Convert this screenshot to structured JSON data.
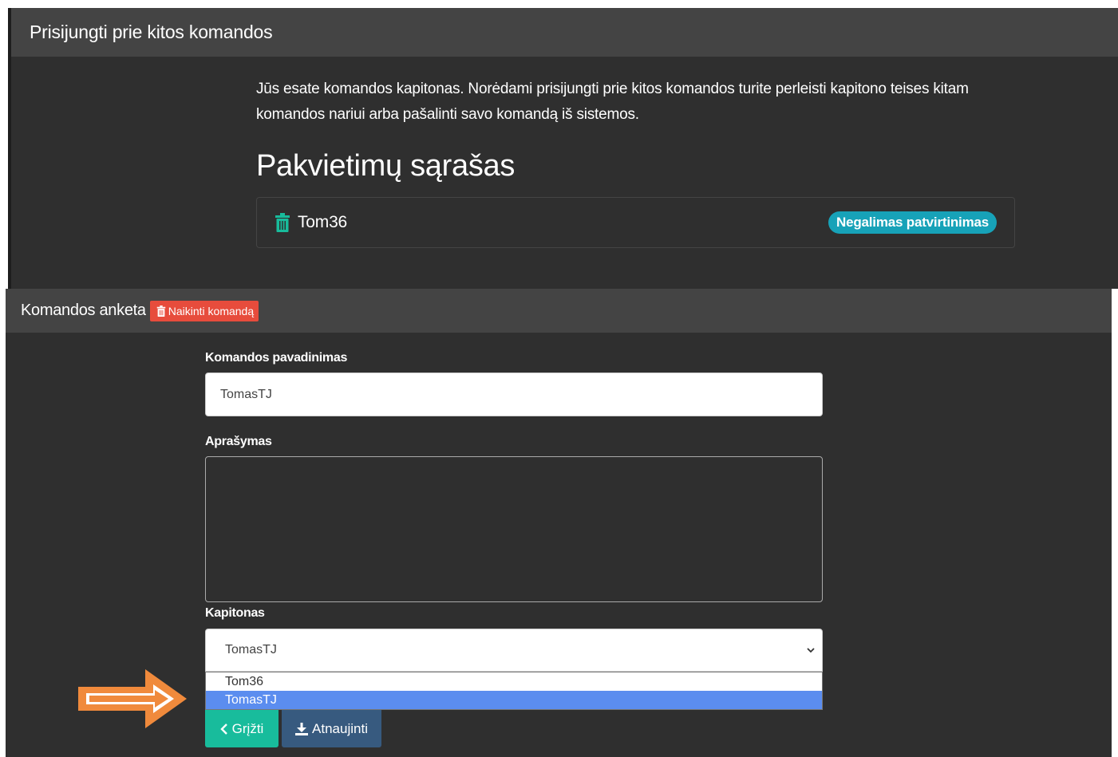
{
  "join_panel": {
    "title": "Prisijungti prie kitos komandos",
    "info_text": "Jūs esate komandos kapitonas. Norėdami prisijungti prie kitos komandos turite perleisti kapitono teises kitam komandos nariui arba pašalinti savo komandą iš sistemos.",
    "invitations_heading": "Pakvietimų sąrašas",
    "invitations": [
      {
        "name": "Tom36",
        "status_badge": "Negalimas patvirtinimas"
      }
    ]
  },
  "team_form": {
    "title": "Komandos anketa",
    "delete_button_label": "Naikinti komandą",
    "name_label": "Komandos pavadinimas",
    "name_value": "TomasTJ",
    "description_label": "Aprašymas",
    "description_value": "",
    "captain_label": "Kapitonas",
    "captain_selected": "TomasTJ",
    "captain_options": [
      "Tom36",
      "TomasTJ"
    ],
    "back_button_label": "Grįžti",
    "update_button_label": "Atnaujinti"
  },
  "colors": {
    "success": "#18bc9c",
    "info": "#17a2b8",
    "danger": "#e74c3c",
    "primary": "#375a7f",
    "highlight": "#5b8def",
    "annotation_arrow": "#f08a3c"
  },
  "icons": {
    "trash": "trash-icon",
    "chevron_left": "chevron-left-icon",
    "download": "download-icon",
    "chevron_down": "chevron-down-icon",
    "annotation_arrow": "arrow-right-icon"
  }
}
